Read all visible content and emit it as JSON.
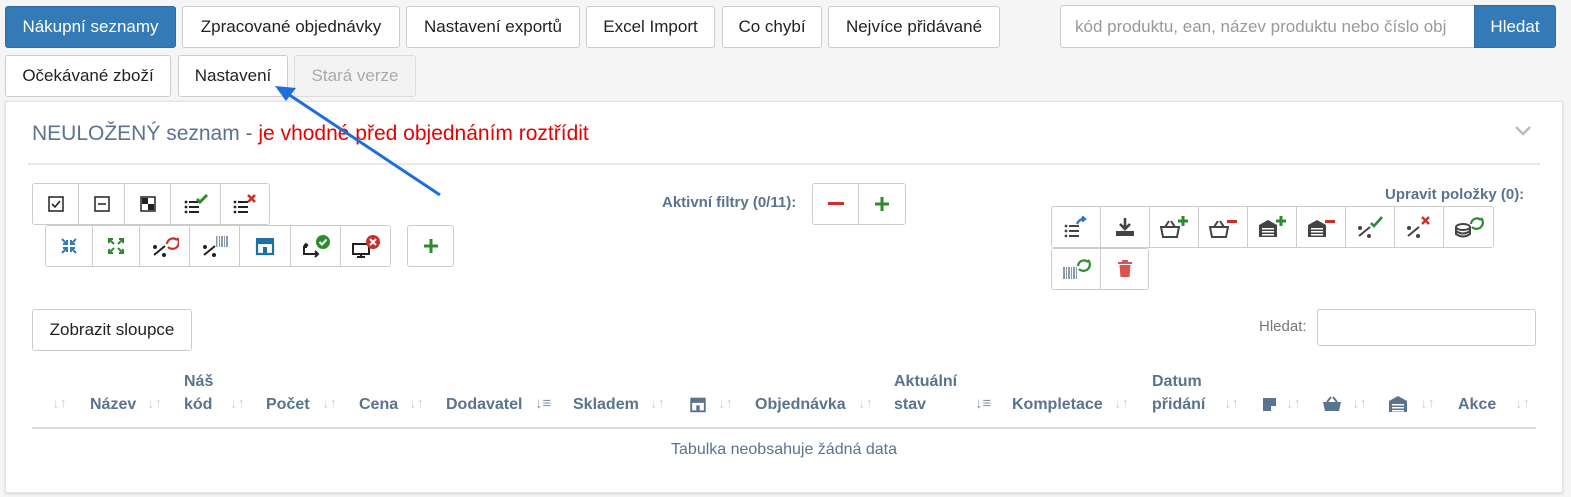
{
  "nav": {
    "tabs": [
      {
        "label": "Nákupní seznamy",
        "active": true
      },
      {
        "label": "Zpracované objednávky"
      },
      {
        "label": "Nastavení exportů"
      },
      {
        "label": "Excel Import"
      },
      {
        "label": "Co chybí"
      },
      {
        "label": "Nejvíce přidávané"
      },
      {
        "label": "Očekávané zboží"
      },
      {
        "label": "Nastavení"
      },
      {
        "label": "Stará verze",
        "disabled": true
      }
    ]
  },
  "search": {
    "placeholder": "kód produktu, ean, název produktu nebo číslo obj",
    "button": "Hledat"
  },
  "panel": {
    "title_main": "NEULOŽENÝ seznam - ",
    "title_warning": "je vhodné před objednáním roztřídit"
  },
  "filters": {
    "label": "Aktivní filtry (0/11):"
  },
  "edit_items": {
    "label": "Upravit položky (0):"
  },
  "table": {
    "show_columns_button": "Zobrazit sloupce",
    "search_label": "Hledat:",
    "columns": [
      "Název",
      "Náš kód",
      "Počet",
      "Cena",
      "Dodavatel",
      "Skladem",
      "Objednávka",
      "Aktuální stav",
      "Kompletace",
      "Datum přidání",
      "Akce"
    ],
    "empty_text": "Tabulka neobsahuje žádná data"
  },
  "colors": {
    "primary": "#337ab7",
    "warning": "#e60000",
    "muted": "#5a738e",
    "green": "#2e8b2e",
    "red": "#c9302c"
  }
}
